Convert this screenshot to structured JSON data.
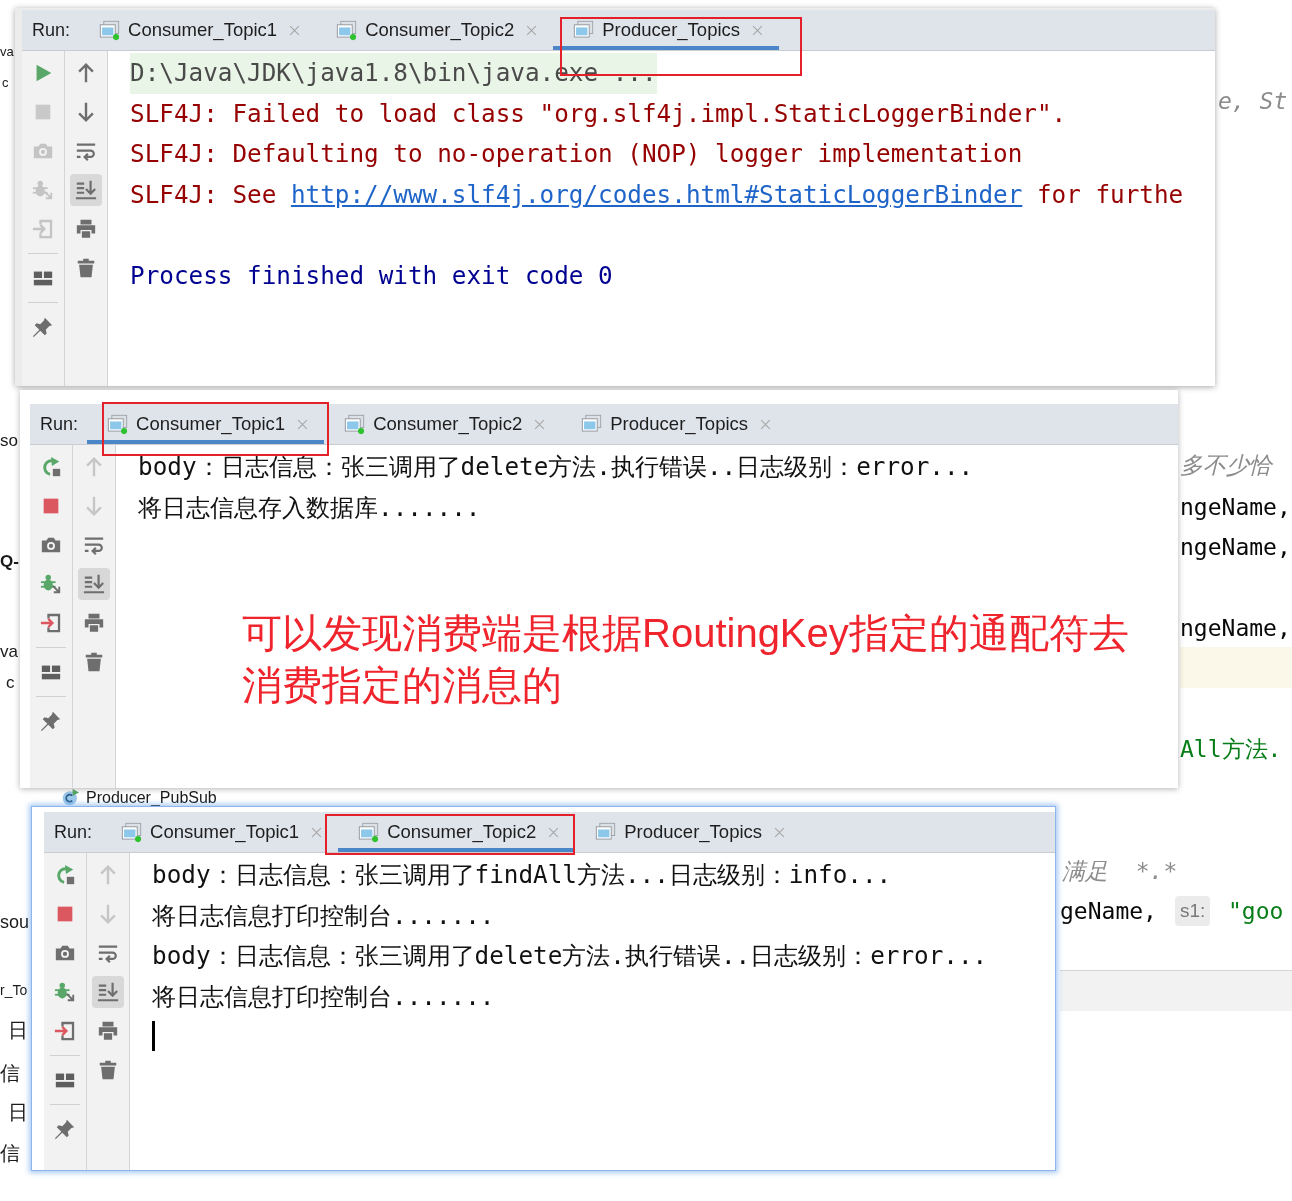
{
  "editor_background": {
    "left_edge": [
      "va",
      "c",
      "so",
      "Q-",
      "va",
      "c",
      "sou",
      "r_To",
      "日",
      "信",
      "日",
      "信"
    ],
    "current_line_highlight": true,
    "right_edge": [
      {
        "kind": "comment",
        "text": "e, St"
      },
      {
        "kind": "comment",
        "text": "多不少恰"
      },
      {
        "kind": "code",
        "text": "ngeName,"
      },
      {
        "kind": "code",
        "text": "ngeName,"
      },
      {
        "kind": "code",
        "text": "ngeName,"
      },
      {
        "kind": "string",
        "text": "All方法."
      }
    ],
    "run_configuration": "Producer_PubSub",
    "lower_right": [
      {
        "kind": "comment",
        "text": "满足  *.*"
      },
      {
        "kind": "code",
        "text": "geName,"
      },
      {
        "kind": "hint",
        "text": "s1:"
      },
      {
        "kind": "string",
        "text": "\"goo"
      }
    ]
  },
  "run_windows": [
    {
      "focused": false,
      "run_label": "Run:",
      "process_running": false,
      "navigation_enabled": true,
      "scroll_to_end": true,
      "caret": false,
      "tabs": [
        {
          "label": "Consumer_Topic1",
          "selected": false,
          "running": true,
          "marked": false
        },
        {
          "label": "Consumer_Topic2",
          "selected": false,
          "running": true,
          "marked": false
        },
        {
          "label": "Producer_Topics",
          "selected": true,
          "running": false,
          "marked": true
        }
      ],
      "lines": [
        {
          "kind": "command",
          "text": "D:\\Java\\JDK\\java1.8\\bin\\java.exe ..."
        },
        {
          "kind": "error",
          "text": "SLF4J: Failed to load class \"org.slf4j.impl.StaticLoggerBinder\"."
        },
        {
          "kind": "error",
          "text": "SLF4J: Defaulting to no-operation (NOP) logger implementation"
        },
        {
          "kind": "error",
          "text": "SLF4J: See ",
          "link": "http://www.slf4j.org/codes.html#StaticLoggerBinder",
          "text_after_link": " for furthe"
        },
        {
          "kind": "blank"
        },
        {
          "kind": "exit",
          "text": "Process finished with exit code 0"
        }
      ]
    },
    {
      "focused": false,
      "run_label": "Run:",
      "process_running": true,
      "navigation_enabled": false,
      "scroll_to_end": true,
      "caret": false,
      "tabs": [
        {
          "label": "Consumer_Topic1",
          "selected": true,
          "running": true,
          "marked": true
        },
        {
          "label": "Consumer_Topic2",
          "selected": false,
          "running": true,
          "marked": false
        },
        {
          "label": "Producer_Topics",
          "selected": false,
          "running": false,
          "marked": false
        }
      ],
      "lines": [
        {
          "kind": "output",
          "text": "body：日志信息：张三调用了delete方法.执行错误..日志级别：error..."
        },
        {
          "kind": "output",
          "text": "将日志信息存入数据库......."
        }
      ],
      "annotation": "可以发现消费端是根据RoutingKey指定的通配符去消费指定的消息的"
    },
    {
      "focused": true,
      "run_label": "Run:",
      "process_running": true,
      "navigation_enabled": false,
      "scroll_to_end": true,
      "caret": true,
      "tabs": [
        {
          "label": "Consumer_Topic1",
          "selected": false,
          "running": true,
          "marked": false
        },
        {
          "label": "Consumer_Topic2",
          "selected": true,
          "running": true,
          "marked": true
        },
        {
          "label": "Producer_Topics",
          "selected": false,
          "running": false,
          "marked": false
        }
      ],
      "lines": [
        {
          "kind": "output",
          "text": "body：日志信息：张三调用了findAll方法...日志级别：info..."
        },
        {
          "kind": "output",
          "text": "将日志信息打印控制台......."
        },
        {
          "kind": "output",
          "text": "body：日志信息：张三调用了delete方法.执行错误..日志级别：error..."
        },
        {
          "kind": "output",
          "text": "将日志信息打印控制台......."
        }
      ]
    }
  ]
}
